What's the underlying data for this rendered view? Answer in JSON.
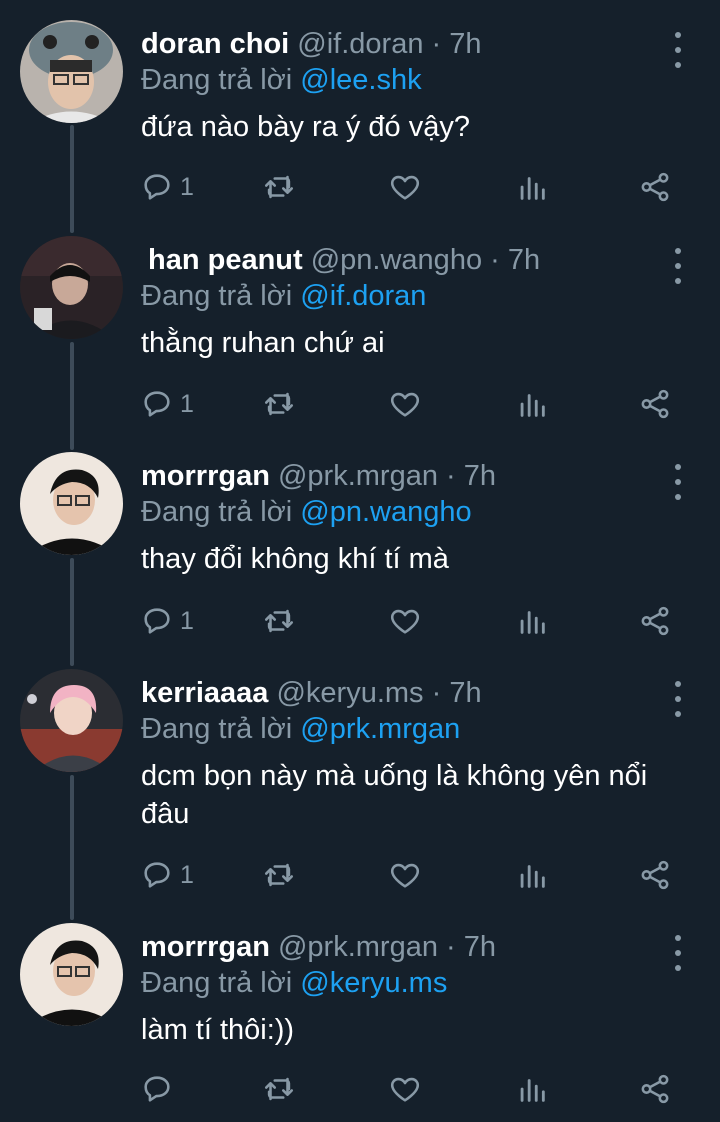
{
  "tweets": [
    {
      "name": "doran choi",
      "handle": "@if.doran",
      "dot": "·",
      "time": "7h",
      "reply_prefix": "Đang trả lời ",
      "reply_to": "@lee.shk",
      "text": "đứa nào bày ra ý đó vậy?",
      "reply_count": "1"
    },
    {
      "name": "han peanut",
      "handle": "@pn.wangho",
      "dot": "·",
      "time": "7h",
      "reply_prefix": "Đang trả lời ",
      "reply_to": "@if.doran",
      "text": "thằng ruhan chứ ai",
      "reply_count": "1"
    },
    {
      "name": "morrrgan",
      "handle": "@prk.mrgan",
      "dot": "·",
      "time": "7h",
      "reply_prefix": "Đang trả lời ",
      "reply_to": "@pn.wangho",
      "text": "thay đổi không khí tí mà",
      "reply_count": "1"
    },
    {
      "name": "kerriaaaa",
      "handle": "@keryu.ms",
      "dot": "·",
      "time": "7h",
      "reply_prefix": "Đang trả lời ",
      "reply_to": "@prk.mrgan",
      "text": "dcm bọn này mà uống là không yên nổi đâu",
      "reply_count": "1"
    },
    {
      "name": "morrrgan",
      "handle": "@prk.mrgan",
      "dot": "·",
      "time": "7h",
      "reply_prefix": "Đang trả lời ",
      "reply_to": "@keryu.ms",
      "text": "làm tí thôi:))",
      "reply_count": ""
    }
  ],
  "icons": {
    "reply": "reply-icon",
    "retweet": "retweet-icon",
    "like": "heart-icon",
    "stats": "stats-icon",
    "share": "share-icon",
    "more": "more-vertical-icon"
  },
  "colors": {
    "background": "#15202b",
    "text": "#ffffff",
    "muted": "#8899a6",
    "mention": "#1da1f2",
    "thread_line": "#3d4b59"
  }
}
